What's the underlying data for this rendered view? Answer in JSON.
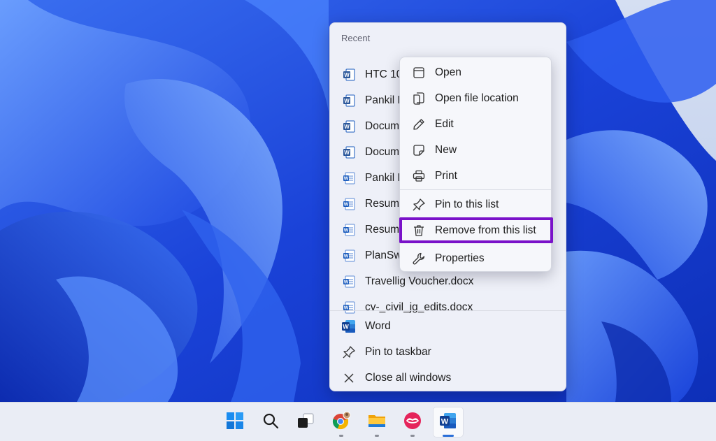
{
  "jumplist": {
    "header": "Recent",
    "recent_items": [
      {
        "label": "HTC 10",
        "icon": "word-doc-old-icon"
      },
      {
        "label": "Pankil F",
        "icon": "word-doc-old-icon"
      },
      {
        "label": "Docum",
        "icon": "word-doc-old-icon"
      },
      {
        "label": "Docum",
        "icon": "word-doc-old-icon"
      },
      {
        "label": "Pankil E",
        "icon": "word-doc-icon"
      },
      {
        "label": "Resume",
        "icon": "word-doc-icon"
      },
      {
        "label": "Resum",
        "icon": "word-doc-icon"
      },
      {
        "label": "PlanSw",
        "icon": "word-doc-icon"
      },
      {
        "label": "Travellig Voucher.docx",
        "icon": "word-doc-icon"
      },
      {
        "label": "cv-_civil_jg_edits.docx",
        "icon": "word-doc-icon"
      }
    ],
    "actions": [
      {
        "label": "Word",
        "icon": "word-app-icon"
      },
      {
        "label": "Pin to taskbar",
        "icon": "pin-icon"
      },
      {
        "label": "Close all windows",
        "icon": "close-icon"
      }
    ]
  },
  "context_menu": {
    "items": [
      {
        "label": "Open",
        "icon": "window-icon"
      },
      {
        "label": "Open file location",
        "icon": "folder-location-icon"
      },
      {
        "label": "Edit",
        "icon": "pencil-icon"
      },
      {
        "label": "New",
        "icon": "new-note-icon"
      },
      {
        "label": "Print",
        "icon": "printer-icon"
      },
      {
        "label": "Pin to this list",
        "icon": "pin-icon"
      },
      {
        "label": "Remove from this list",
        "icon": "trash-icon"
      },
      {
        "label": "Properties",
        "icon": "wrench-icon"
      }
    ],
    "highlighted_item": "Remove from this list",
    "highlight_color": "#7a12c9"
  },
  "taskbar": {
    "apps": [
      {
        "name": "Start",
        "icon": "windows-start-icon"
      },
      {
        "name": "Search",
        "icon": "search-icon"
      },
      {
        "name": "Task View",
        "icon": "task-view-icon"
      },
      {
        "name": "Chrome",
        "icon": "chrome-icon"
      },
      {
        "name": "File Explorer",
        "icon": "file-explorer-icon"
      },
      {
        "name": "Kiss app",
        "icon": "lips-app-icon"
      },
      {
        "name": "Word",
        "icon": "word-app-icon"
      }
    ],
    "active_app": "Word"
  },
  "colors": {
    "wallpaper_blue": "#1b3fd6",
    "word_blue": "#185abd",
    "taskbar_bg": "#eaedf5",
    "menu_bg": "#f6f7fb"
  }
}
